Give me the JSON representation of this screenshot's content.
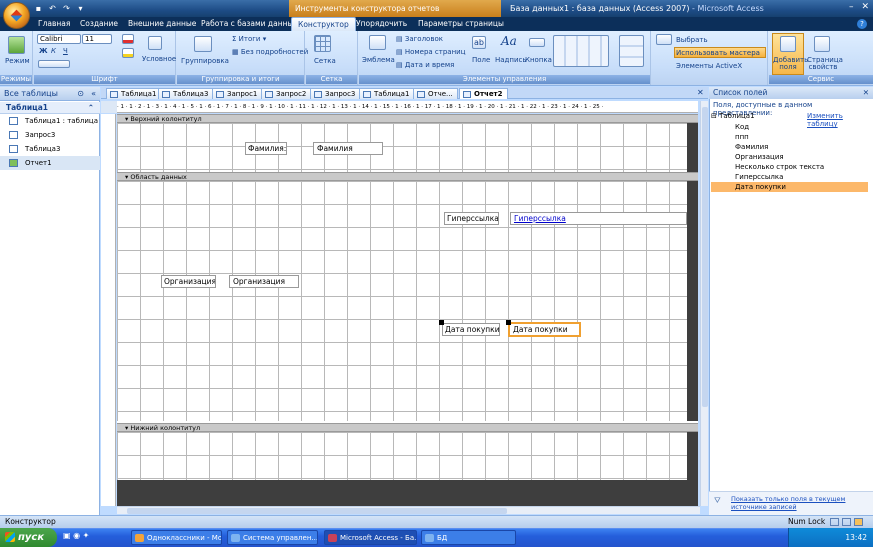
{
  "title_bar": {
    "context_tools": "Инструменты конструктора отчетов",
    "doc_title": "База данных1 : база данных (Access 2007)",
    "app_name": " - Microsoft Access",
    "minimize": "–",
    "close": "✕"
  },
  "ribbon_tabs": [
    "Главная",
    "Создание",
    "Внешние данные",
    "Работа с базами данных",
    "Конструктор",
    "Упорядочить",
    "Параметры страницы"
  ],
  "ribbon": {
    "views": {
      "view_label": "Режим",
      "group_label": "Режимы"
    },
    "font": {
      "font_name": "Calibri",
      "font_size": "11",
      "bold": "Ж",
      "italic": "К",
      "underline": "Ч",
      "conditional": "Условное",
      "group_label": "Шрифт"
    },
    "grouping": {
      "grouping_label": "Группировка",
      "totals_label": "Итоги",
      "hide_details": "Без подробностей",
      "group_label": "Группировка и итоги"
    },
    "gridlines": {
      "gridlines_label": "Сетка",
      "group_label": "Сетка"
    },
    "controls": {
      "logo": "Эмблема",
      "title": "Заголовок",
      "page_numbers": "Номера страниц",
      "date_time": "Дата и время",
      "field": "Поле",
      "label": "Надпись",
      "button": "Кнопка",
      "group_label": "Элементы управления"
    },
    "wizard": {
      "select": "Выбрать",
      "use_wizard": "Использовать мастера",
      "activex": "Элементы ActiveX"
    },
    "tools": {
      "add_fields": "Добавить поля",
      "property_sheet": "Страница свойств",
      "group_label": "Сервис"
    }
  },
  "nav_pane": {
    "header": "Все таблицы",
    "group": "Таблица1",
    "items": [
      {
        "label": "Таблица1 : таблица",
        "selected": false
      },
      {
        "label": "Запрос3",
        "selected": false
      },
      {
        "label": "Таблица3",
        "selected": false
      },
      {
        "label": "Отчет1",
        "selected": true
      }
    ]
  },
  "doc_tabs": [
    "Таблица1",
    "Таблица3",
    "Запрос1",
    "Запрос2",
    "Запрос3",
    "Таблица1",
    "Отче...",
    "Отчет2"
  ],
  "ruler": "· 1 · 1 · 2 · 1 · 3 · 1 · 4 · 1 · 5 · 1 · 6 · 1 · 7 · 1 · 8 · 1 · 9 · 1 · 10 · 1 · 11 · 1 · 12 · 1 · 13 · 1 · 14 · 1 · 15 · 1 · 16 · 1 · 17 · 1 · 18 · 1 · 19 · 1 · 20 · 1 · 21 · 1 · 22 · 1 · 23 · 1 · 24 · 1 · 25 ·",
  "sections": {
    "page_header": "Верхний колонтитул",
    "detail": "Область данных",
    "page_footer": "Нижний колонтитул"
  },
  "controls": {
    "surname_label": "Фамилия:",
    "surname_field": "Фамилия",
    "hyperlink_label": "Гиперссылка:",
    "hyperlink_field": "Гиперссылка",
    "org_label": "Организация:",
    "org_field": "Организация",
    "purchase_label": "Дата покупки:",
    "purchase_field": "Дата покупки"
  },
  "field_list": {
    "title": "Список полей",
    "subtitle": "Поля, доступные в данном представлении:",
    "table": "Таблица1",
    "edit_table": "Изменить таблицу",
    "fields": [
      "Код",
      "ппп",
      "Фамилия",
      "Организация",
      "Несколько строк текста",
      "Гиперссылка",
      "Дата покупки"
    ],
    "highlighted": "Дата покупки",
    "footer_link": "Показать только поля в текущем источнике записей"
  },
  "status_bar": {
    "mode": "Конструктор",
    "num_lock": "Num Lock"
  },
  "taskbar": {
    "start": "пуск",
    "tasks": [
      "Одноклассники - Мо...",
      "Система управлен...",
      "Microsoft Access - Ба...",
      "БД"
    ],
    "active_task": "Microsoft Access - Ба...",
    "clock": "13:42"
  }
}
